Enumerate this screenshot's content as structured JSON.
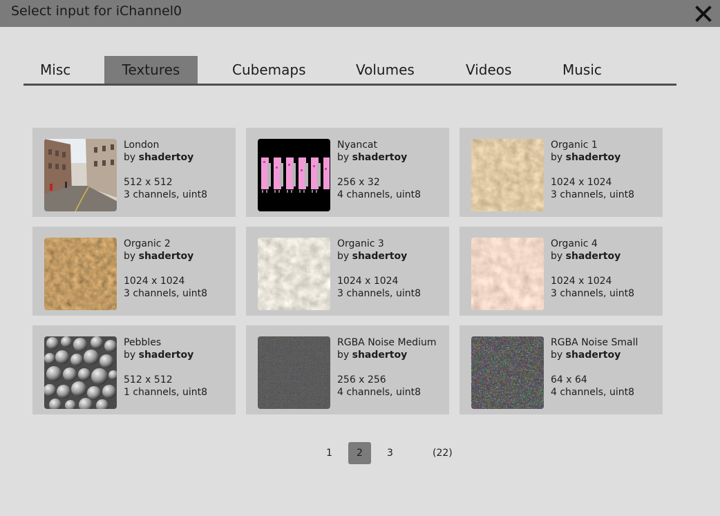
{
  "dialog": {
    "title": "Select input for iChannel0",
    "close_icon": "close-icon"
  },
  "tabs": [
    {
      "label": "Misc",
      "active": false
    },
    {
      "label": "Textures",
      "active": true
    },
    {
      "label": "Cubemaps",
      "active": false
    },
    {
      "label": "Volumes",
      "active": false
    },
    {
      "label": "Videos",
      "active": false
    },
    {
      "label": "Music",
      "active": false
    }
  ],
  "textures": [
    {
      "name": "London",
      "by_prefix": "by",
      "author": "shadertoy",
      "size": "512 x 512",
      "format": "3 channels, uint8",
      "thumb": "street-photo"
    },
    {
      "name": "Nyancat",
      "by_prefix": "by",
      "author": "shadertoy",
      "size": "256 x 32",
      "format": "4 channels, uint8",
      "thumb": "nyancat-sprites"
    },
    {
      "name": "Organic 1",
      "by_prefix": "by",
      "author": "shadertoy",
      "size": "1024 x 1024",
      "format": "3 channels, uint8",
      "thumb": "organic-texture"
    },
    {
      "name": "Organic 2",
      "by_prefix": "by",
      "author": "shadertoy",
      "size": "1024 x 1024",
      "format": "3 channels, uint8",
      "thumb": "organic-texture"
    },
    {
      "name": "Organic 3",
      "by_prefix": "by",
      "author": "shadertoy",
      "size": "1024 x 1024",
      "format": "3 channels, uint8",
      "thumb": "organic-texture"
    },
    {
      "name": "Organic 4",
      "by_prefix": "by",
      "author": "shadertoy",
      "size": "1024 x 1024",
      "format": "3 channels, uint8",
      "thumb": "organic-texture"
    },
    {
      "name": "Pebbles",
      "by_prefix": "by",
      "author": "shadertoy",
      "size": "512 x 512",
      "format": "1 channels, uint8",
      "thumb": "pebbles-texture"
    },
    {
      "name": "RGBA Noise Medium",
      "by_prefix": "by",
      "author": "shadertoy",
      "size": "256 x 256",
      "format": "4 channels, uint8",
      "thumb": "noise-texture"
    },
    {
      "name": "RGBA Noise Small",
      "by_prefix": "by",
      "author": "shadertoy",
      "size": "64 x 64",
      "format": "4 channels, uint8",
      "thumb": "noise-texture"
    }
  ],
  "pagination": {
    "pages": [
      "1",
      "2",
      "3"
    ],
    "current": "2",
    "total": "(22)"
  },
  "colors": {
    "titlebar": "#7b7b7b",
    "background": "#dedede",
    "card": "#c8c8c8",
    "active_tab": "#7b7b7b"
  }
}
